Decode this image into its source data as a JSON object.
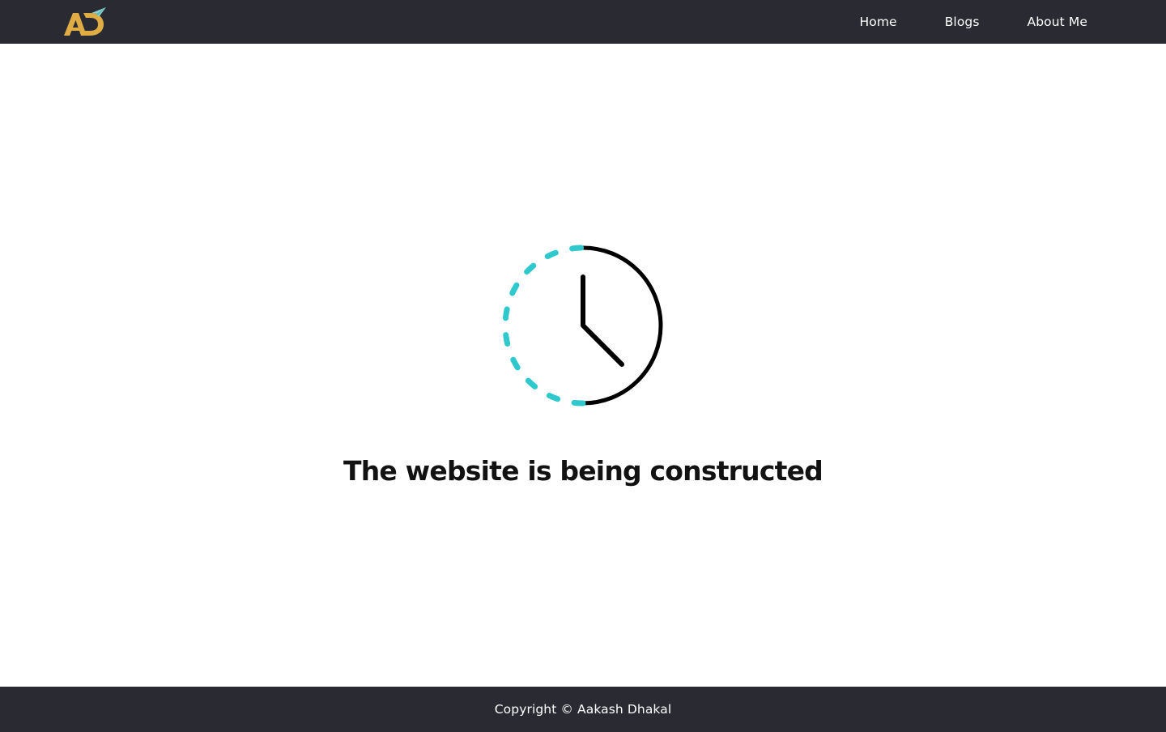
{
  "header": {
    "logo_icon": "ad-monogram-logo-with-paper-plane",
    "nav": [
      {
        "label": "Home"
      },
      {
        "label": "Blogs"
      },
      {
        "label": "About Me"
      }
    ]
  },
  "main": {
    "illustration_icon": "half-dashed-clock-icon",
    "headline": "The website is being constructed"
  },
  "footer": {
    "copyright": "Copyright © Aakash Dhakal"
  },
  "colors": {
    "bar_background": "#292a32",
    "logo_gold": "#e0ad45",
    "accent_teal": "#2fc9cd",
    "text_dark": "#121212"
  }
}
